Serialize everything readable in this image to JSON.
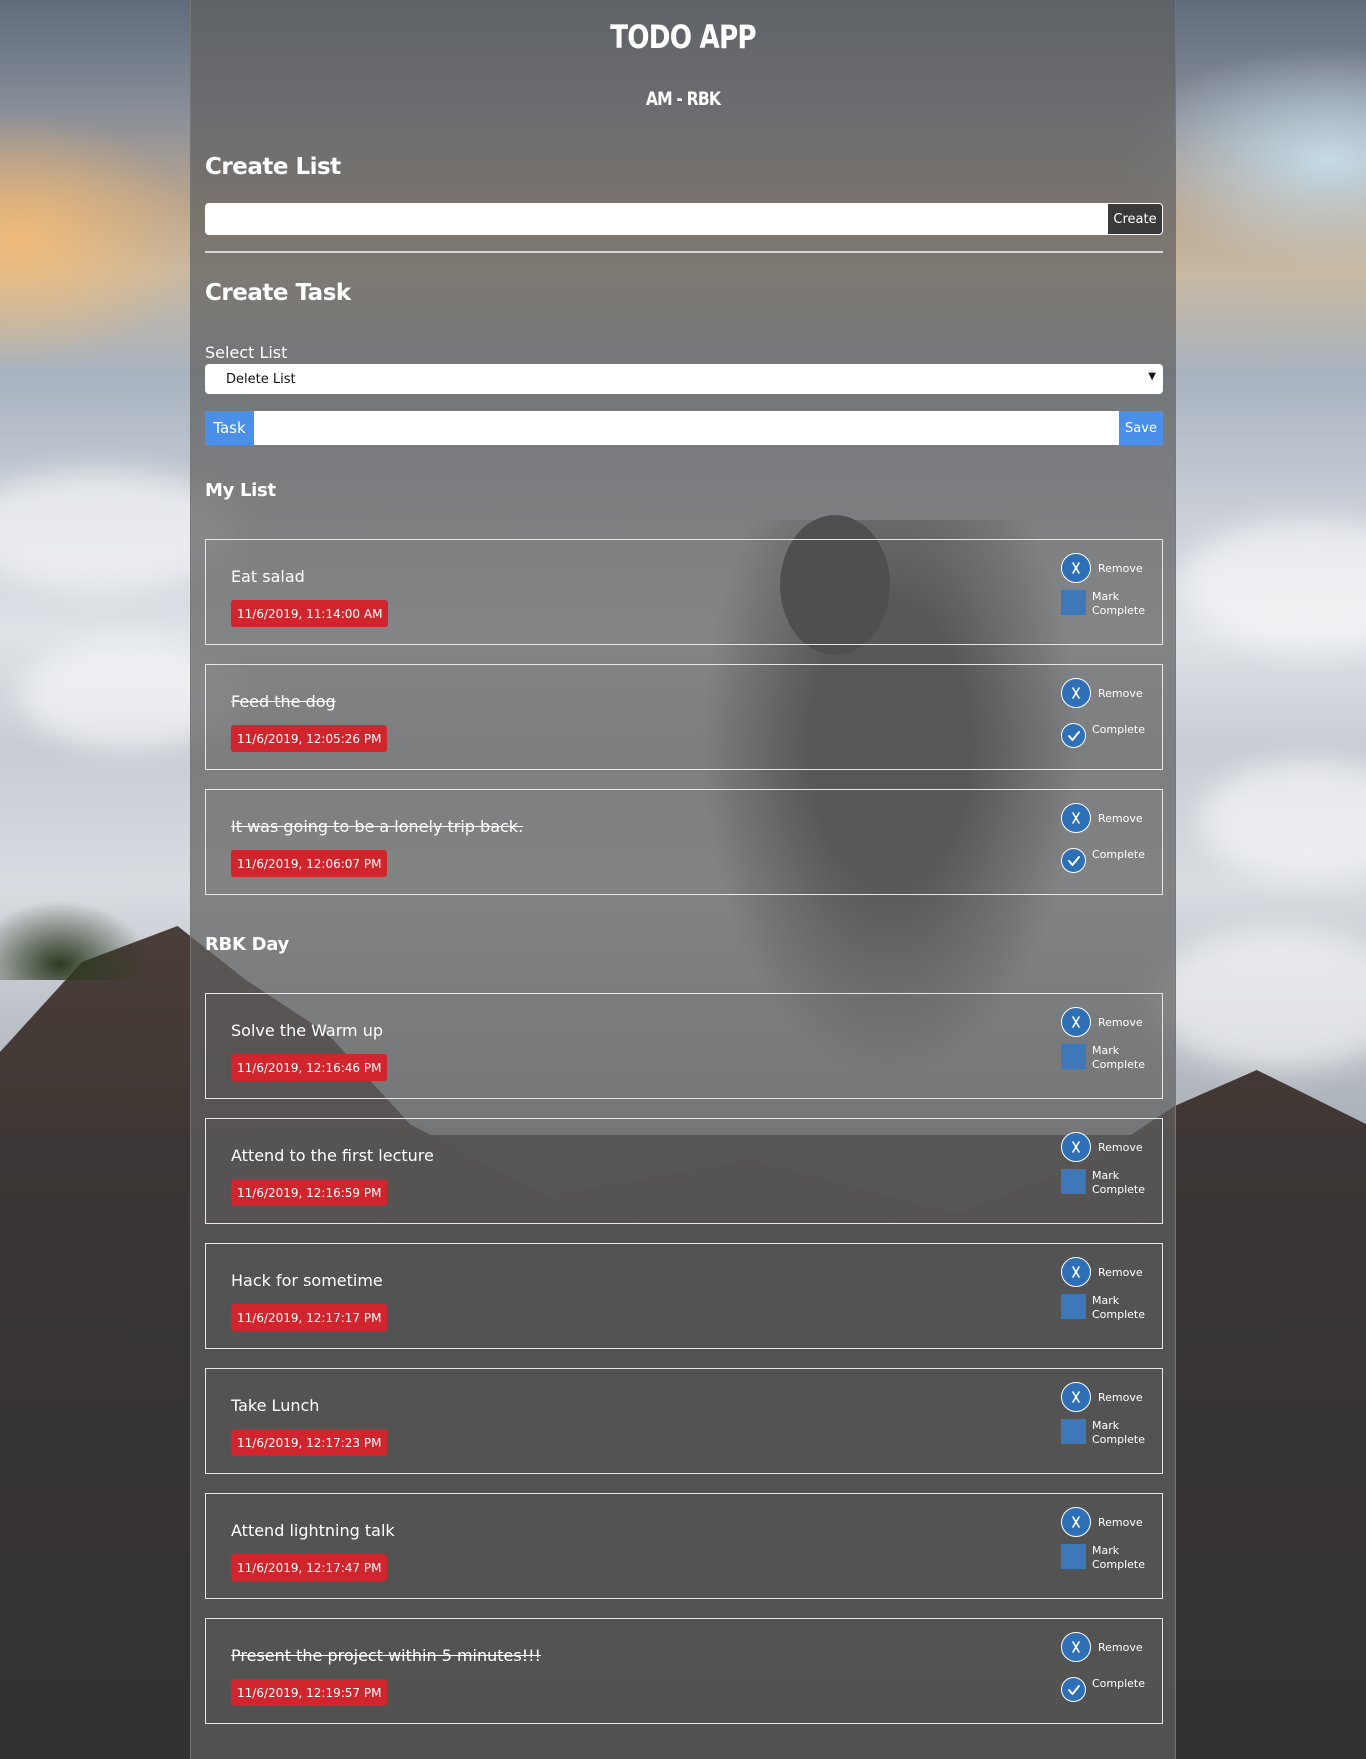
{
  "header": {
    "title": "TODO APP",
    "subtitle": "AM - RBK"
  },
  "create_list": {
    "heading": "Create List",
    "input_value": "",
    "button_label": "Create"
  },
  "create_task": {
    "heading": "Create Task",
    "select_label": "Select List",
    "select_value": "Delete List",
    "task_label": "Task",
    "task_input_value": "",
    "save_label": "Save"
  },
  "lists": [
    {
      "name": "My List",
      "tasks": [
        {
          "text": "Eat salad",
          "date": "11/6/2019, 11:14:00 AM",
          "completed": false
        },
        {
          "text": "Feed the dog",
          "date": "11/6/2019, 12:05:26 PM",
          "completed": true
        },
        {
          "text": "It was going to be a lonely trip back.",
          "date": "11/6/2019, 12:06:07 PM",
          "completed": true
        }
      ]
    },
    {
      "name": "RBK Day",
      "tasks": [
        {
          "text": "Solve the Warm up",
          "date": "11/6/2019, 12:16:46 PM",
          "completed": false
        },
        {
          "text": "Attend to the first lecture",
          "date": "11/6/2019, 12:16:59 PM",
          "completed": false
        },
        {
          "text": "Hack for sometime",
          "date": "11/6/2019, 12:17:17 PM",
          "completed": false
        },
        {
          "text": "Take Lunch",
          "date": "11/6/2019, 12:17:23 PM",
          "completed": false
        },
        {
          "text": "Attend lightning talk",
          "date": "11/6/2019, 12:17:47 PM",
          "completed": false
        },
        {
          "text": "Present the project within 5 minutes!!!",
          "date": "11/6/2019, 12:19:57 PM",
          "completed": true
        }
      ]
    }
  ],
  "labels": {
    "remove": "Remove",
    "mark_complete_line1": "Mark",
    "mark_complete_line2": "Complete",
    "complete": "Complete"
  },
  "icons": {
    "remove": "x-icon",
    "completed": "checkmark-icon"
  },
  "colors": {
    "accent_blue": "#4a90e8",
    "date_badge_red": "#d0252c",
    "panel_overlay": "#5f5f5f"
  }
}
